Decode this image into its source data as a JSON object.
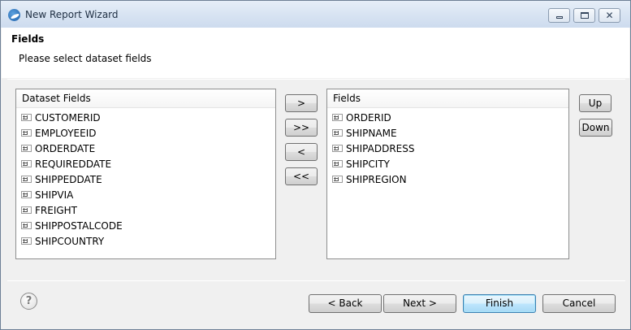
{
  "window": {
    "title": "New Report Wizard",
    "controls": {
      "minimize": "minimize",
      "maximize": "maximize",
      "close": "✕"
    }
  },
  "header": {
    "title": "Fields",
    "description": "Please select dataset fields"
  },
  "dataset_fields": {
    "header": "Dataset Fields",
    "items": [
      "CUSTOMERID",
      "EMPLOYEEID",
      "ORDERDATE",
      "REQUIREDDATE",
      "SHIPPEDDATE",
      "SHIPVIA",
      "FREIGHT",
      "SHIPPOSTALCODE",
      "SHIPCOUNTRY"
    ]
  },
  "fields": {
    "header": "Fields",
    "items": [
      "ORDERID",
      "SHIPNAME",
      "SHIPADDRESS",
      "SHIPCITY",
      "SHIPREGION"
    ]
  },
  "move_buttons": {
    "add": ">",
    "add_all": ">>",
    "remove": "<",
    "remove_all": "<<"
  },
  "order_buttons": {
    "up": "Up",
    "down": "Down"
  },
  "footer": {
    "help": "?",
    "back": "< Back",
    "next": "Next >",
    "finish": "Finish",
    "cancel": "Cancel"
  },
  "icons": {
    "app": "report-wizard-icon",
    "field": "field-icon",
    "help": "help-icon"
  },
  "colors": {
    "titlebar": "#d7e3f2",
    "finish_accent": "#3c7fb1"
  }
}
